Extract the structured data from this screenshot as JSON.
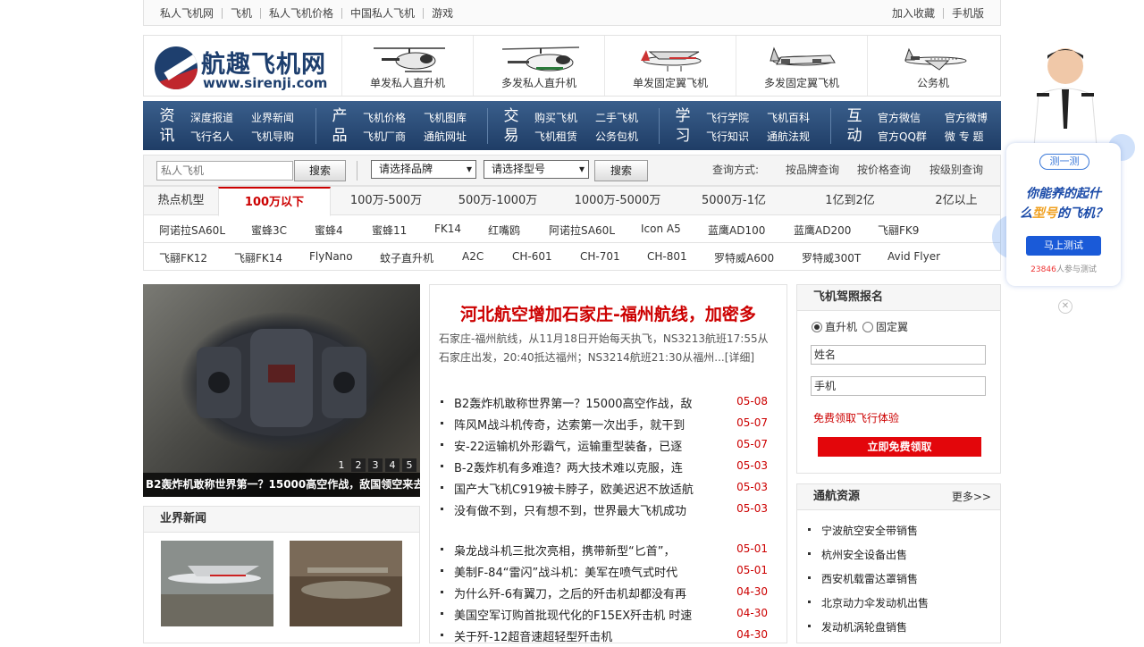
{
  "topbar": {
    "links": [
      "私人飞机网",
      "飞机",
      "私人飞机价格",
      "中国私人飞机",
      "游戏"
    ],
    "right": [
      "加入收藏",
      "手机版"
    ]
  },
  "logo": {
    "cn": "航趣飞机网",
    "url": "www.sirenji.com"
  },
  "categories": [
    "单发私人直升机",
    "多发私人直升机",
    "单发固定翼飞机",
    "多发固定翼飞机",
    "公务机"
  ],
  "nav": [
    {
      "big": "资讯",
      "items": [
        "深度报道",
        "业界新闻",
        "飞行名人",
        "飞机导购"
      ]
    },
    {
      "big": "产品",
      "items": [
        "飞机价格",
        "飞机图库",
        "飞机厂商",
        "通航网址"
      ]
    },
    {
      "big": "交易",
      "items": [
        "购买飞机",
        "二手飞机",
        "飞机租赁",
        "公务包机"
      ]
    },
    {
      "big": "学习",
      "items": [
        "飞行学院",
        "飞机百科",
        "飞行知识",
        "通航法规"
      ]
    },
    {
      "big": "互动",
      "items": [
        "官方微信",
        "官方微博",
        "官方QQ群",
        "微 专 题"
      ]
    }
  ],
  "search": {
    "placeholder": "私人飞机",
    "button": "搜索",
    "brand_select": "请选择品牌",
    "model_select": "请选择型号",
    "button2": "搜索",
    "query_label": "查询方式:",
    "query_links": [
      "按品牌查询",
      "按价格查询",
      "按级别查询"
    ]
  },
  "price_tabs": [
    "热点机型",
    "100万以下",
    "100万-500万",
    "500万-1000万",
    "1000万-5000万",
    "5000万-1亿",
    "1亿到2亿",
    "2亿以上"
  ],
  "models_row1": [
    "阿诺拉SA60L",
    "蜜蜂3C",
    "蜜蜂4",
    "蜜蜂11",
    "FK14",
    "红嘴鸥",
    "阿诺拉SA60L",
    "Icon A5",
    "蓝鹰AD100",
    "蓝鹰AD200",
    "飞翮FK9"
  ],
  "models_row2": [
    "飞翮FK12",
    "飞翮FK14",
    "FlyNano",
    "蚊子直升机",
    "A2C",
    "CH-601",
    "CH-701",
    "CH-801",
    "罗特威A600",
    "罗特威300T",
    "Avid Flyer"
  ],
  "banner": {
    "caption": "B2轰炸机敢称世界第一？15000高空作战，敌国领空来去",
    "pages": [
      "1",
      "2",
      "3",
      "4",
      "5"
    ]
  },
  "industry": {
    "title": "业界新闻"
  },
  "headline": {
    "title": "河北航空增加石家庄-福州航线，加密多",
    "summary": "石家庄-福州航线，从11月18日开始每天执飞，NS3213航班17:55从石家庄出发，20:40抵达福州；NS3214航班21:30从福州...[详细]"
  },
  "news1": [
    {
      "t": "B2轰炸机敢称世界第一？15000高空作战，敌",
      "d": "05-08"
    },
    {
      "t": "阵风M战斗机传奇，达索第一次出手，就干到",
      "d": "05-07"
    },
    {
      "t": "安-22运输机外形霸气，运输重型装备，已逐",
      "d": "05-07"
    },
    {
      "t": "B-2轰炸机有多难造？两大技术难以克服，连",
      "d": "05-03"
    },
    {
      "t": "国产大飞机C919被卡脖子，欧美迟迟不放适航",
      "d": "05-03"
    },
    {
      "t": "没有做不到，只有想不到，世界最大飞机成功",
      "d": "05-03"
    }
  ],
  "news2": [
    {
      "t": "枭龙战斗机三批次亮相，携带新型“匕首”，",
      "d": "05-01"
    },
    {
      "t": "美制F-84“雷闪”战斗机：美军在喷气式时代",
      "d": "05-01"
    },
    {
      "t": "为什么歼-6有翼刀，之后的歼击机却都没有再",
      "d": "04-30"
    },
    {
      "t": "美国空军订购首批现代化的F15EX歼击机 时速",
      "d": "04-30"
    },
    {
      "t": "关于歼-12超音速超轻型歼击机",
      "d": "04-30"
    }
  ],
  "signup": {
    "title": "飞机驾照报名",
    "radio1": "直升机",
    "radio2": "固定翼",
    "name_placeholder": "姓名",
    "phone_placeholder": "手机",
    "free_link": "免费领取飞行体验",
    "button": "立即免费领取"
  },
  "resources": {
    "title": "通航资源",
    "more": "更多>>",
    "items": [
      "宁波航空安全带销售",
      "杭州安全设备出售",
      "西安机载雷达罩销售",
      "北京动力伞发动机出售",
      "发动机涡轮盘销售"
    ]
  },
  "ad": {
    "tag": "测一测",
    "line1a": "你能养的起什",
    "line2a": "么",
    "line2b": "型号",
    "line2c": "的飞机？",
    "button": "马上测试",
    "count": "23846",
    "count_suffix": "人参与测试",
    "close": "✕"
  },
  "colors": {
    "accent_red": "#c00000",
    "nav_blue": "#1f3d66",
    "button_red": "#e3060b"
  }
}
